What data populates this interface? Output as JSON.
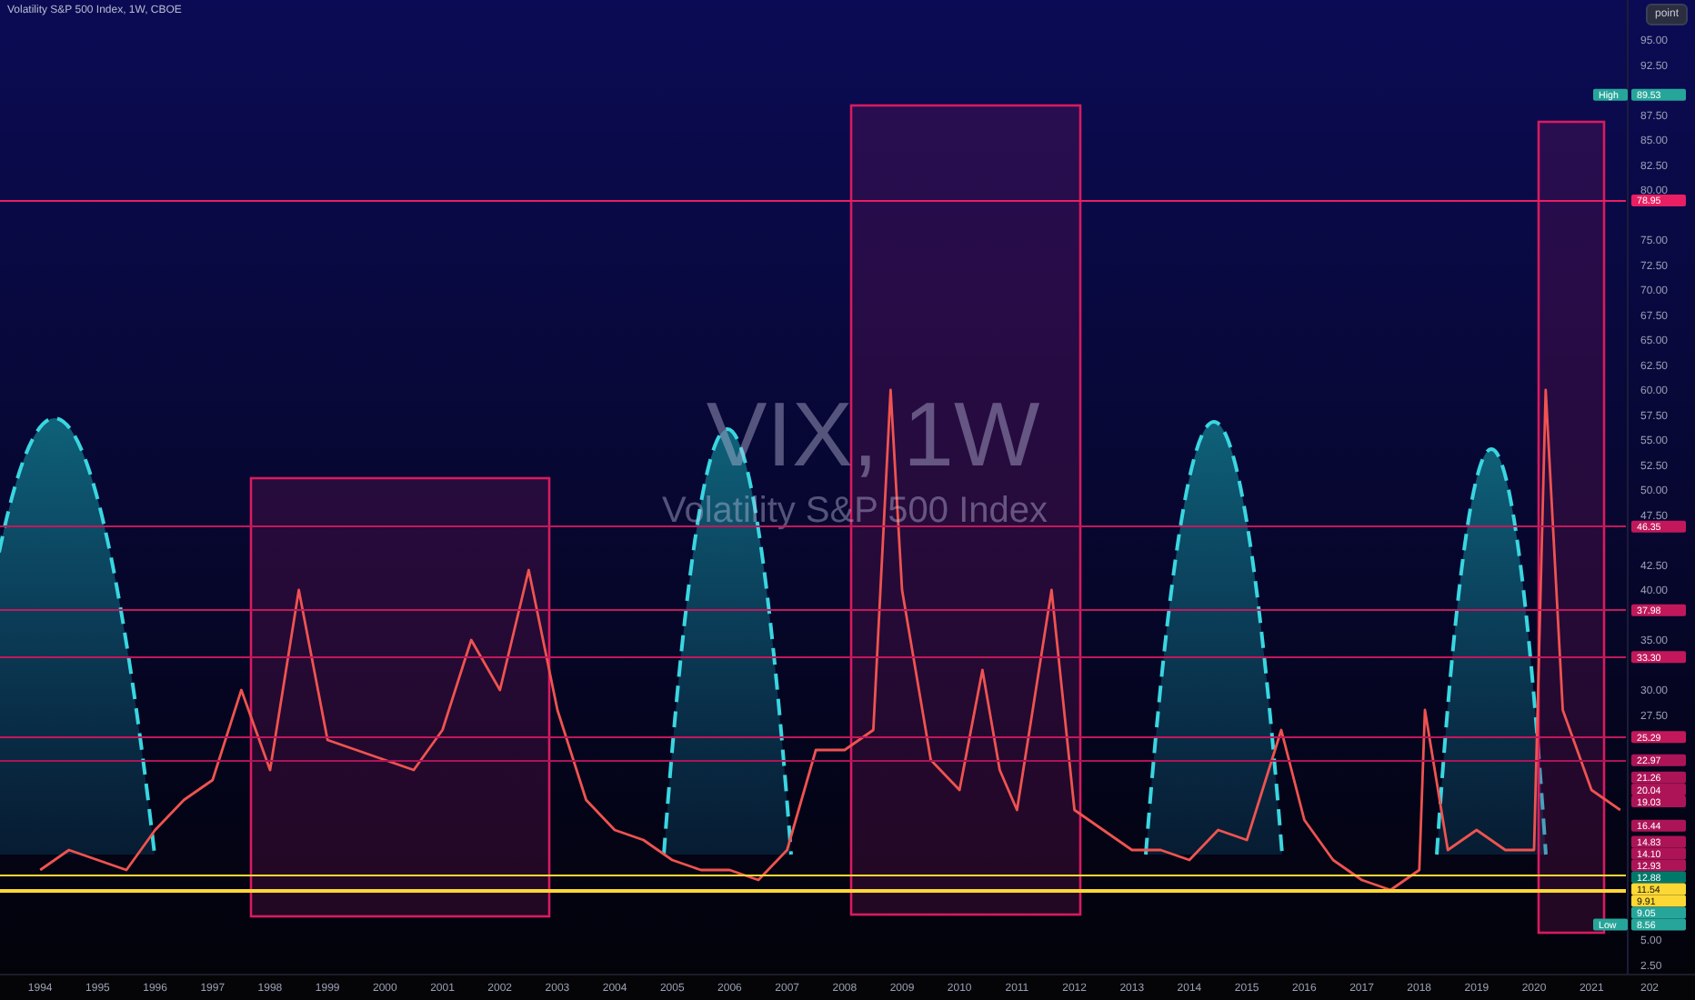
{
  "title": "Volatility S&P 500 Index, 1W, CBOE",
  "scale_button": "point",
  "watermark": {
    "symbol": "VIX, 1W",
    "name": "Volatility S&P 500 Index"
  },
  "chart_data": {
    "type": "line",
    "x": [
      1994,
      1994.5,
      1995,
      1995.5,
      1996,
      1996.5,
      1997,
      1997.5,
      1998,
      1998.5,
      1999,
      1999.5,
      2000,
      2000.5,
      2001,
      2001.5,
      2002,
      2002.5,
      2003,
      2003.5,
      2004,
      2004.5,
      2005,
      2005.5,
      2006,
      2006.5,
      2007,
      2007.5,
      2008,
      2008.5,
      2008.8,
      2009,
      2009.5,
      2010,
      2010.4,
      2010.7,
      2011,
      2011.6,
      2012,
      2012.5,
      2013,
      2013.5,
      2014,
      2014.5,
      2015,
      2015.6,
      2016,
      2016.5,
      2017,
      2017.5,
      2018,
      2018.1,
      2018.5,
      2019,
      2019.5,
      2020,
      2020.2,
      2020.5,
      2021,
      2021.5
    ],
    "series": [
      {
        "color": "#ef5350",
        "values": [
          12,
          14,
          13,
          12,
          16,
          19,
          21,
          30,
          22,
          40,
          25,
          24,
          23,
          22,
          26,
          35,
          30,
          42,
          28,
          19,
          16,
          15,
          13,
          12,
          12,
          11,
          14,
          24,
          24,
          26,
          60,
          40,
          23,
          20,
          32,
          22,
          18,
          40,
          18,
          16,
          14,
          14,
          13,
          16,
          15,
          26,
          17,
          13,
          11,
          10,
          12,
          28,
          14,
          16,
          14,
          14,
          60,
          28,
          20,
          18
        ]
      }
    ],
    "xlim": [
      1993.3,
      2022.8
    ],
    "ylim": [
      1.55,
      99
    ],
    "xticks": [
      1994,
      1995,
      1996,
      1997,
      1998,
      1999,
      2000,
      2001,
      2002,
      2003,
      2004,
      2005,
      2006,
      2007,
      2008,
      2009,
      2010,
      2011,
      2012,
      2013,
      2014,
      2015,
      2016,
      2017,
      2018,
      2019,
      2020,
      2021
    ],
    "yticks": [
      {
        "value": 95,
        "label": "95.00"
      },
      {
        "value": 92.5,
        "label": "92.50"
      },
      {
        "value": 87.5,
        "label": "87.50"
      },
      {
        "value": 85,
        "label": "85.00"
      },
      {
        "value": 82.5,
        "label": "82.50"
      },
      {
        "value": 80,
        "label": "80.00"
      },
      {
        "value": 75,
        "label": "75.00"
      },
      {
        "value": 72.5,
        "label": "72.50"
      },
      {
        "value": 70,
        "label": "70.00"
      },
      {
        "value": 67.5,
        "label": "67.50"
      },
      {
        "value": 65,
        "label": "65.00"
      },
      {
        "value": 62.5,
        "label": "62.50"
      },
      {
        "value": 60,
        "label": "60.00"
      },
      {
        "value": 57.5,
        "label": "57.50"
      },
      {
        "value": 55,
        "label": "55.00"
      },
      {
        "value": 52.5,
        "label": "52.50"
      },
      {
        "value": 50,
        "label": "50.00"
      },
      {
        "value": 47.5,
        "label": "47.50"
      },
      {
        "value": 42.5,
        "label": "42.50"
      },
      {
        "value": 40,
        "label": "40.00"
      },
      {
        "value": 35,
        "label": "35.00"
      },
      {
        "value": 30,
        "label": "30.00"
      },
      {
        "value": 27.5,
        "label": "27.50"
      },
      {
        "value": 5,
        "label": "5.00"
      },
      {
        "value": 2.5,
        "label": "2.50"
      }
    ]
  },
  "levels": [
    {
      "label": "78.95",
      "color": "#e91e63"
    },
    {
      "label": "46.35",
      "color": "#c2185b"
    },
    {
      "label": "37.98",
      "color": "#c2185b"
    },
    {
      "label": "33.30",
      "color": "#c2185b"
    },
    {
      "label": "25.29",
      "color": "#c2185b"
    },
    {
      "label": "22.97",
      "color": "#ad1457"
    },
    {
      "label": "11.54",
      "color": "#fdd835"
    },
    {
      "label": "9.91",
      "color": "#fdd835"
    }
  ],
  "time_axis_cut_label": "202",
  "price_labels": [
    {
      "label": "89.53",
      "tag": "High",
      "color": "#26a69a"
    },
    {
      "label": "21.26",
      "color": "#ad1457"
    },
    {
      "label": "20.04",
      "color": "#ad1457"
    },
    {
      "label": "19.03",
      "color": "#ad1457"
    },
    {
      "label": "16.44",
      "color": "#ad1457"
    },
    {
      "label": "14.83",
      "color": "#ad1457"
    },
    {
      "label": "14.10",
      "color": "#ad1457"
    },
    {
      "label": "12.93",
      "color": "#ad1457"
    },
    {
      "label": "12.88",
      "color": "#00796b"
    },
    {
      "label": "9.05",
      "color": "#26a69a"
    },
    {
      "label": "8.56",
      "tag": "Low",
      "color": "#26a69a"
    }
  ]
}
